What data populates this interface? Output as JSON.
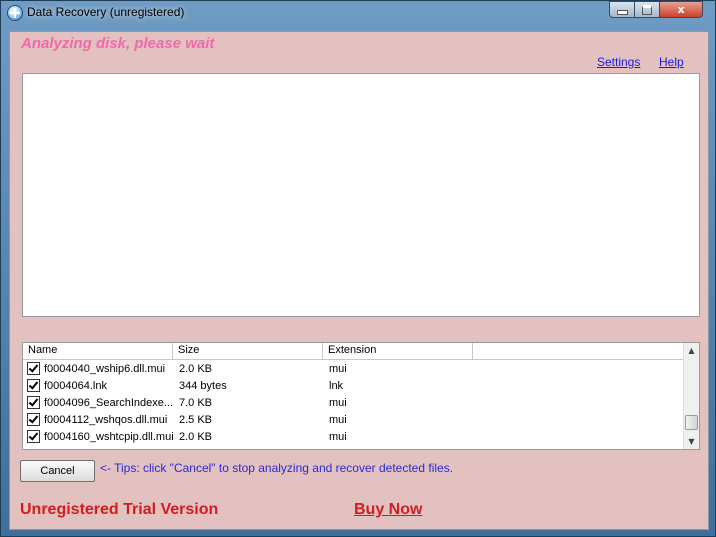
{
  "window": {
    "title": "Data Recovery (unregistered)",
    "controls": {
      "minimize": "minimize",
      "maximize": "maximize",
      "close": "x"
    }
  },
  "header": {
    "status": "Analyzing disk, please wait",
    "status_color": "#f06aa8",
    "links": {
      "settings": "Settings",
      "help": "Help"
    }
  },
  "file_list": {
    "columns": [
      "Name",
      "Size",
      "Extension",
      ""
    ],
    "rows": [
      {
        "checked": true,
        "name": "f0004040_wship6.dll.mui",
        "size": "2.0 KB",
        "extension": "mui"
      },
      {
        "checked": true,
        "name": "f0004064.lnk",
        "size": "344 bytes",
        "extension": "lnk"
      },
      {
        "checked": true,
        "name": "f0004096_SearchIndexe...",
        "size": "7.0 KB",
        "extension": "mui"
      },
      {
        "checked": true,
        "name": "f0004112_wshqos.dll.mui",
        "size": "2.5 KB",
        "extension": "mui"
      },
      {
        "checked": true,
        "name": "f0004160_wshtcpip.dll.mui",
        "size": "2.0 KB",
        "extension": "mui"
      }
    ]
  },
  "actions": {
    "cancel_label": "Cancel",
    "tips": "<- Tips: click \"Cancel\" to stop analyzing and recover detected files."
  },
  "footer": {
    "trial_text": "Unregistered Trial Version",
    "buy_label": "Buy Now",
    "accent_color": "#d41c1c"
  },
  "icons": {
    "app": "app-recovery-icon",
    "scroll_up": "chevron-up-icon",
    "scroll_down": "chevron-down-icon",
    "checkbox": "checkmark-icon"
  }
}
